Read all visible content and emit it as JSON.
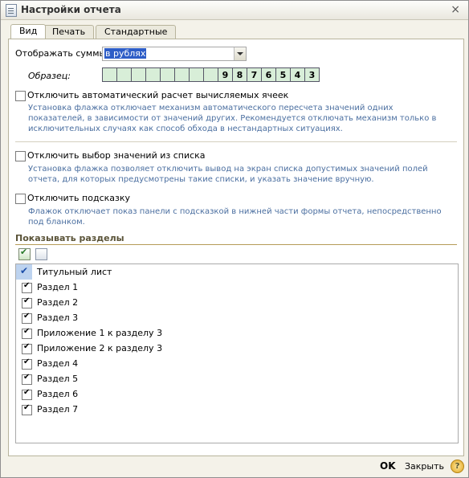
{
  "window": {
    "title": "Настройки отчета",
    "close_symbol": "×"
  },
  "tabs": [
    {
      "label": "Вид",
      "active": true
    },
    {
      "label": "Печать",
      "active": false
    },
    {
      "label": "Стандартные",
      "active": false
    }
  ],
  "display_sums": {
    "label": "Отображать суммы",
    "value": "в рублях"
  },
  "sample": {
    "label": "Образец:",
    "digits": [
      "",
      "",
      "",
      "",
      "",
      "",
      "",
      "",
      "9",
      "8",
      "7",
      "6",
      "5",
      "4",
      "3"
    ]
  },
  "options": [
    {
      "label": "Отключить автоматический расчет вычисляемых ячеек",
      "checked": false,
      "description": "Установка флажка отключает механизм автоматического пересчета значений одних показателей, в зависимости от значений других. Рекомендуется отключать механизм только в исключительных случаях как способ обхода в нестандартных ситуациях."
    },
    {
      "label": "Отключить выбор значений из списка",
      "checked": false,
      "description": "Установка флажка позволяет отключить вывод на экран списка допустимых значений полей отчета, для которых предусмотрены такие списки, и указать значение вручную."
    },
    {
      "label": "Отключить подсказку",
      "checked": false,
      "description": "Флажок отключает показ панели с подсказкой в нижней части формы отчета, непосредственно под бланком."
    }
  ],
  "sections": {
    "title": "Показывать разделы",
    "items": [
      {
        "label": "Титульный лист",
        "checked": true,
        "selected": true
      },
      {
        "label": "Раздел 1",
        "checked": true
      },
      {
        "label": "Раздел 2",
        "checked": true
      },
      {
        "label": "Раздел 3",
        "checked": true
      },
      {
        "label": "Приложение 1 к разделу 3",
        "checked": true
      },
      {
        "label": "Приложение 2 к разделу 3",
        "checked": true
      },
      {
        "label": "Раздел 4",
        "checked": true
      },
      {
        "label": "Раздел 5",
        "checked": true
      },
      {
        "label": "Раздел 6",
        "checked": true
      },
      {
        "label": "Раздел 7",
        "checked": true
      }
    ]
  },
  "footer": {
    "ok": "OK",
    "close": "Закрыть",
    "help": "?"
  }
}
